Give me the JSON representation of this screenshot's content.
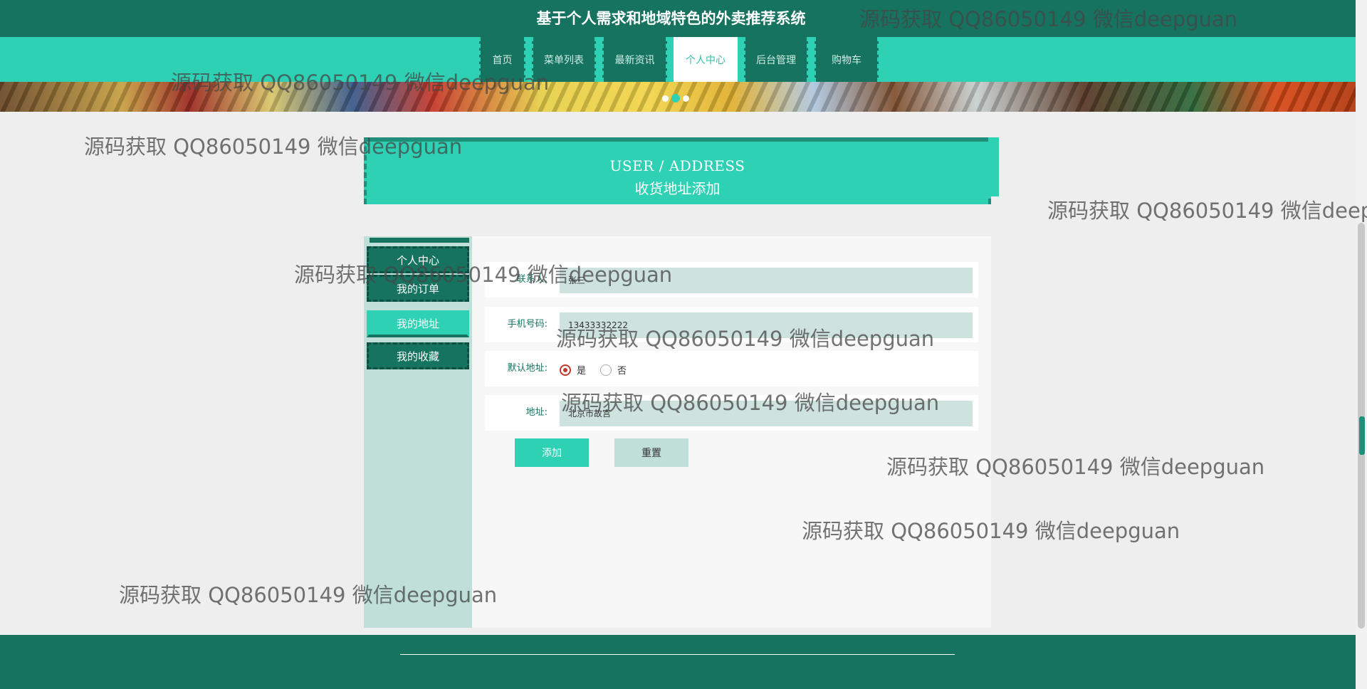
{
  "header": {
    "title": "基于个人需求和地域特色的外卖推荐系统"
  },
  "nav": {
    "items": [
      "首页",
      "菜单列表",
      "最新资讯",
      "个人中心",
      "后台管理",
      "购物车"
    ],
    "active": "个人中心"
  },
  "banner": {
    "dots": 3,
    "active_dot": 2
  },
  "section": {
    "title_en": "USER / ADDRESS",
    "title_cn": "收货地址添加"
  },
  "sidebar": {
    "items": [
      "个人中心",
      "我的订单",
      "我的地址",
      "我的收藏"
    ],
    "active": "我的地址"
  },
  "form": {
    "contact_label": "联系人:",
    "contact_value": "张三",
    "phone_label": "手机号码:",
    "phone_value": "13433332222",
    "default_label": "默认地址:",
    "default_yes": "是",
    "default_no": "否",
    "default_selected": "是",
    "address_label": "地址:",
    "address_value": "北京市故宫"
  },
  "buttons": {
    "add": "添加",
    "reset": "重置"
  },
  "watermark": {
    "text": "源码获取 QQ86050149 微信deepguan"
  },
  "colors": {
    "dark_green": "#16735f",
    "accent": "#2fd1b4",
    "light_green": "#bfdfd8"
  }
}
